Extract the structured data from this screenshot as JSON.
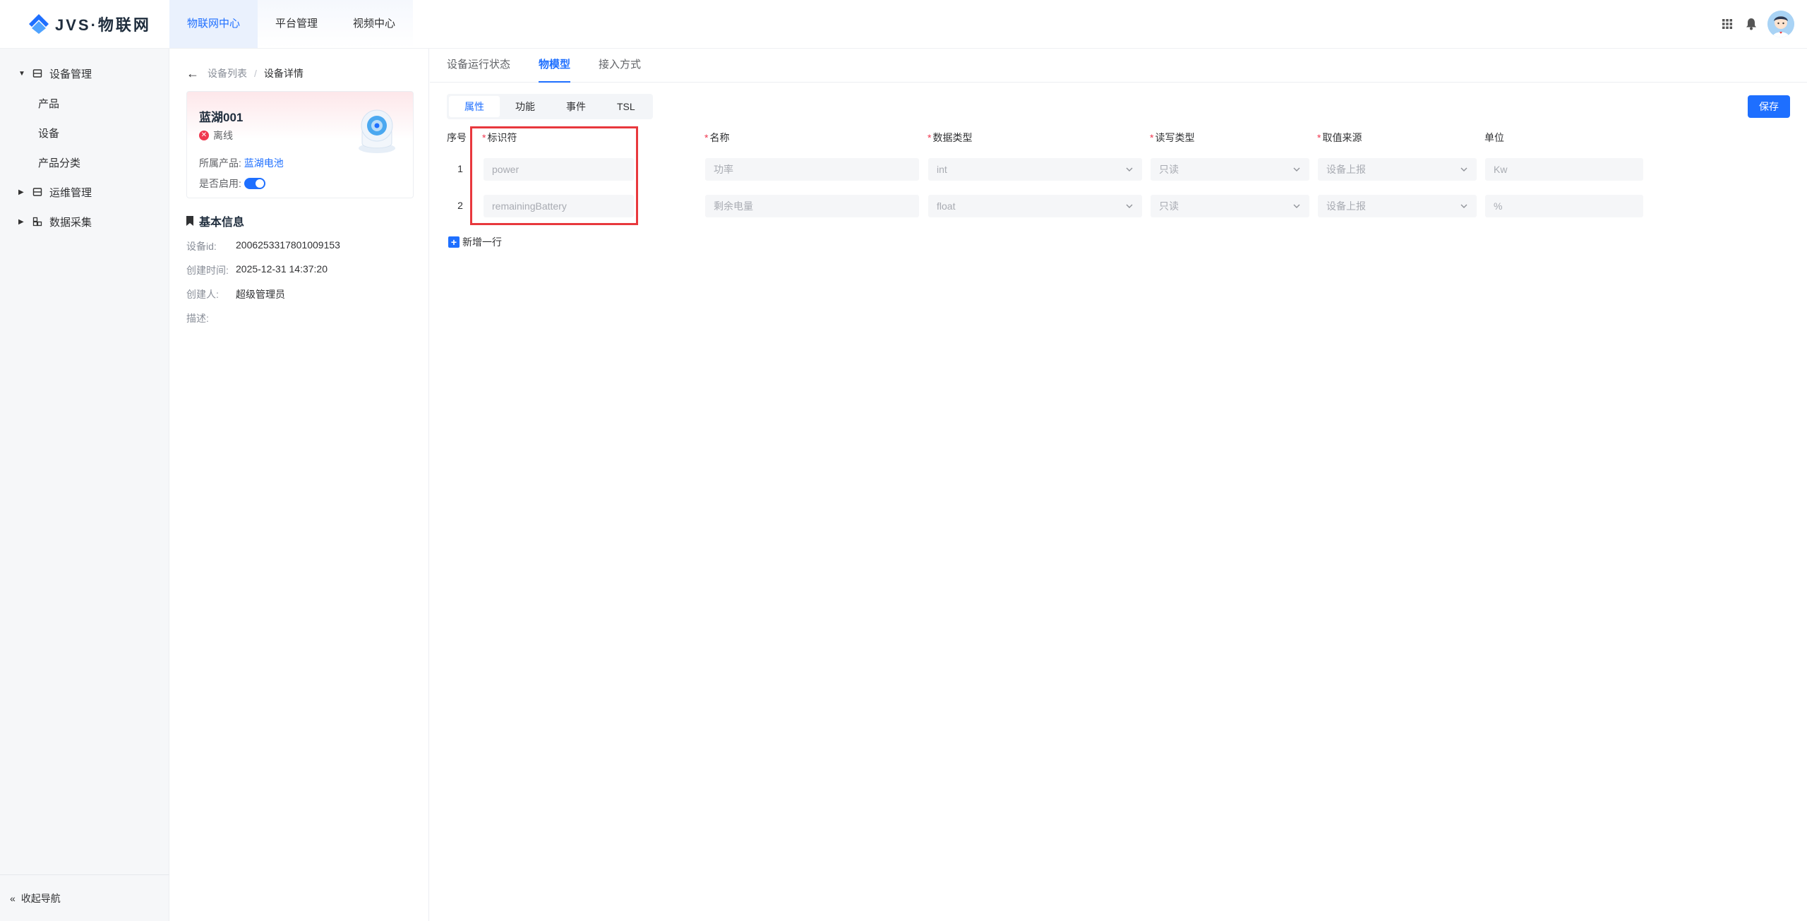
{
  "app": {
    "logo_text": "JVS·物联网"
  },
  "topnav": [
    {
      "label": "物联网中心",
      "active": true
    },
    {
      "label": "平台管理",
      "active": false
    },
    {
      "label": "视频中心",
      "active": false
    }
  ],
  "sidebar": {
    "groups": [
      {
        "label": "设备管理",
        "expanded": true,
        "items": [
          "产品",
          "设备",
          "产品分类"
        ]
      },
      {
        "label": "运维管理",
        "expanded": false
      },
      {
        "label": "数据采集",
        "expanded": false
      }
    ],
    "collapse_label": "收起导航"
  },
  "breadcrumb": {
    "parent": "设备列表",
    "current": "设备详情"
  },
  "device": {
    "name": "蓝湖001",
    "status": "离线",
    "product_label": "所属产品:",
    "product_value": "蓝湖电池",
    "enable_label": "是否启用:",
    "enabled": true
  },
  "basic_info": {
    "title": "基本信息",
    "fields": [
      {
        "label": "设备id:",
        "value": "2006253317801009153"
      },
      {
        "label": "创建时间:",
        "value": "2025-12-31 14:37:20"
      },
      {
        "label": "创建人:",
        "value": "超级管理员"
      },
      {
        "label": "描述:",
        "value": ""
      }
    ]
  },
  "main_tabs": [
    {
      "label": "设备运行状态",
      "active": false
    },
    {
      "label": "物模型",
      "active": true
    },
    {
      "label": "接入方式",
      "active": false
    }
  ],
  "sub_tabs": [
    {
      "label": "属性",
      "active": true
    },
    {
      "label": "功能",
      "active": false
    },
    {
      "label": "事件",
      "active": false
    },
    {
      "label": "TSL",
      "active": false
    }
  ],
  "save_label": "保存",
  "table": {
    "headers": {
      "index": "序号",
      "identifier": "标识符",
      "name": "名称",
      "data_type": "数据类型",
      "rw_type": "读写类型",
      "source": "取值来源",
      "unit": "单位"
    },
    "rows": [
      {
        "index": "1",
        "identifier": "power",
        "name": "功率",
        "data_type": "int",
        "rw_type": "只读",
        "source": "设备上报",
        "unit": "Kw"
      },
      {
        "index": "2",
        "identifier": "remainingBattery",
        "name": "剩余电量",
        "data_type": "float",
        "rw_type": "只读",
        "source": "设备上报",
        "unit": "%"
      }
    ],
    "add_row_label": "新增一行"
  },
  "colors": {
    "primary": "#1e6fff",
    "danger": "#f0374f",
    "highlight": "#e8383d"
  }
}
